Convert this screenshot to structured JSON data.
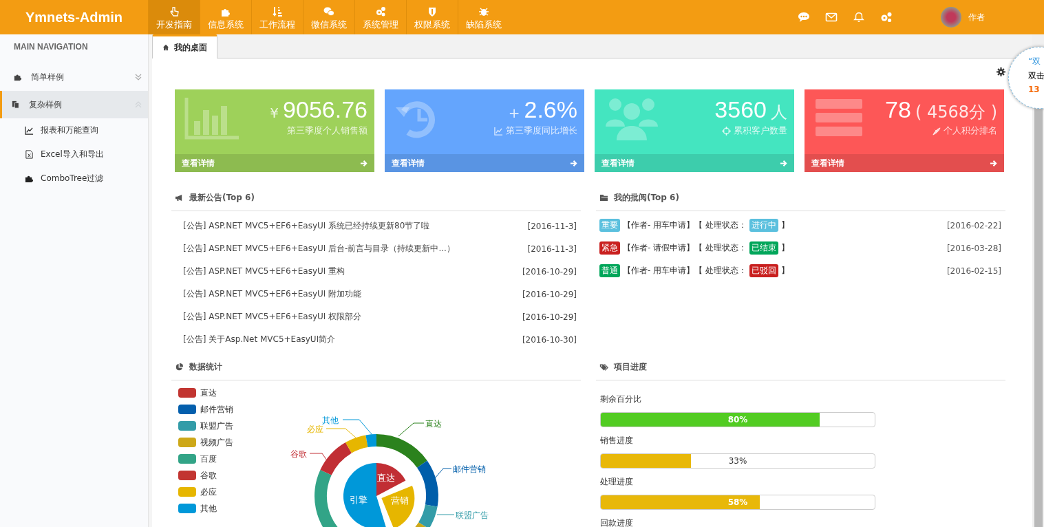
{
  "header": {
    "logo": "Ymnets-Admin",
    "nav": [
      {
        "label": "开发指南",
        "selected": true
      },
      {
        "label": "信息系统",
        "selected": false
      },
      {
        "label": "工作流程",
        "selected": false
      },
      {
        "label": "微信系统",
        "selected": false
      },
      {
        "label": "系统管理",
        "selected": false
      },
      {
        "label": "权限系统",
        "selected": false
      },
      {
        "label": "缺陷系统",
        "selected": false
      }
    ],
    "user": {
      "name": "作者"
    }
  },
  "sidebar": {
    "heading": "MAIN NAVIGATION",
    "items": [
      {
        "label": "简单样例",
        "expanded": false,
        "selected": false
      },
      {
        "label": "复杂样例",
        "expanded": true,
        "selected": true,
        "children": [
          {
            "label": "报表和万能查询"
          },
          {
            "label": "Excel导入和导出"
          },
          {
            "label": "ComboTree过滤"
          }
        ]
      }
    ]
  },
  "tabs": [
    {
      "label": "我的桌面",
      "selected": true
    }
  ],
  "stats": [
    {
      "prefix": "¥",
      "value": "9056.76",
      "caption": "第三季度个人销售额",
      "link": "查看详情",
      "color": "#9ed15a"
    },
    {
      "prefix": "+",
      "value": "2.6%",
      "caption": "第三季度同比增长",
      "link": "查看详情",
      "color": "#64a5fd"
    },
    {
      "value": "3560",
      "suffix": "人",
      "caption": "累积客户数量",
      "link": "查看详情",
      "color": "#44e5c0"
    },
    {
      "value": "78",
      "suffix": "( 4568分 )",
      "caption": "个人积分排名",
      "link": "查看详情",
      "color": "#fd5757"
    }
  ],
  "notices": {
    "title": "最新公告(Top 6)",
    "items": [
      {
        "text": "[公告] ASP.NET MVC5+EF6+EasyUI 系统已经持续更新80节了啦",
        "date": "[2016-11-3]"
      },
      {
        "text": "[公告] ASP.NET MVC5+EF6+EasyUI 后台-前言与目录（持续更新中...）",
        "date": "[2016-11-3]"
      },
      {
        "text": "[公告] ASP.NET MVC5+EF6+EasyUI 重构",
        "date": "[2016-10-29]"
      },
      {
        "text": "[公告] ASP.NET MVC5+EF6+EasyUI 附加功能",
        "date": "[2016-10-29]"
      },
      {
        "text": "[公告] ASP.NET MVC5+EF6+EasyUI 权限部分",
        "date": "[2016-10-29]"
      },
      {
        "text": "[公告] 关于Asp.Net MVC5+EasyUI简介",
        "date": "[2016-10-30]"
      }
    ]
  },
  "reviews": {
    "title": "我的批阅(Top 6)",
    "items": [
      {
        "tag": {
          "text": "重要",
          "color": "#5bc0de"
        },
        "text": "【作者- 用车申请】【 处理状态：",
        "status": {
          "text": "进行中",
          "color": "#5bc0de"
        },
        "close": "】",
        "date": "[2016-02-22]"
      },
      {
        "tag": {
          "text": "紧急",
          "color": "#c9201f"
        },
        "text": "【作者- 请假申请】【 处理状态：",
        "status": {
          "text": "已结束",
          "color": "#00a65a"
        },
        "close": "】",
        "date": "[2016-03-28]"
      },
      {
        "tag": {
          "text": "普通",
          "color": "#00a65a"
        },
        "text": "【作者- 用车申请】【 处理状态：",
        "status": {
          "text": "已驳回",
          "color": "#c9201f"
        },
        "close": "】",
        "date": "[2016-02-15]"
      }
    ]
  },
  "statistics": {
    "title": "数据统计",
    "legend": [
      {
        "label": "直达",
        "color": "#c23531"
      },
      {
        "label": "邮件营销",
        "color": "#045fad"
      },
      {
        "label": "联盟广告",
        "color": "#339ca8"
      },
      {
        "label": "视频广告",
        "color": "#cda819"
      },
      {
        "label": "百度",
        "color": "#32a487"
      },
      {
        "label": "谷歌",
        "color": "#c23531"
      },
      {
        "label": "必应",
        "color": "#e6b600"
      },
      {
        "label": "其他",
        "color": "#0098d9"
      }
    ],
    "outer": [
      {
        "label": "直达",
        "color": "#2b821d"
      },
      {
        "label": "邮件营销",
        "color": "#005eaa"
      },
      {
        "label": "联盟广告",
        "color": "#339ca8"
      },
      {
        "color": "#cda819"
      },
      {
        "color": "#32a487"
      },
      {
        "label": "谷歌",
        "color": "#c12e34"
      },
      {
        "label": "必应",
        "color": "#e6b600"
      },
      {
        "label": "其他",
        "color": "#0098d9"
      }
    ],
    "inner": [
      {
        "label": "直达",
        "color": "#c12e34"
      },
      {
        "label": "营销",
        "color": "#e6b600"
      },
      {
        "label": "引擎",
        "color": "#0098d9"
      }
    ]
  },
  "progress": {
    "title": "项目进度",
    "bars": [
      {
        "label": "剩余百分比",
        "level": 0.8,
        "reading": "80%",
        "color": "#52cc22"
      },
      {
        "label": "销售进度",
        "level": 0.33,
        "reading": "33%",
        "color": "#e8b80a"
      },
      {
        "label": "处理进度",
        "level": 0.58,
        "reading": "58%",
        "color": "#e8b80a"
      },
      {
        "label": "回款进度"
      }
    ]
  },
  "bubble": {
    "title": "“双",
    "line": "双击",
    "count": "13"
  }
}
